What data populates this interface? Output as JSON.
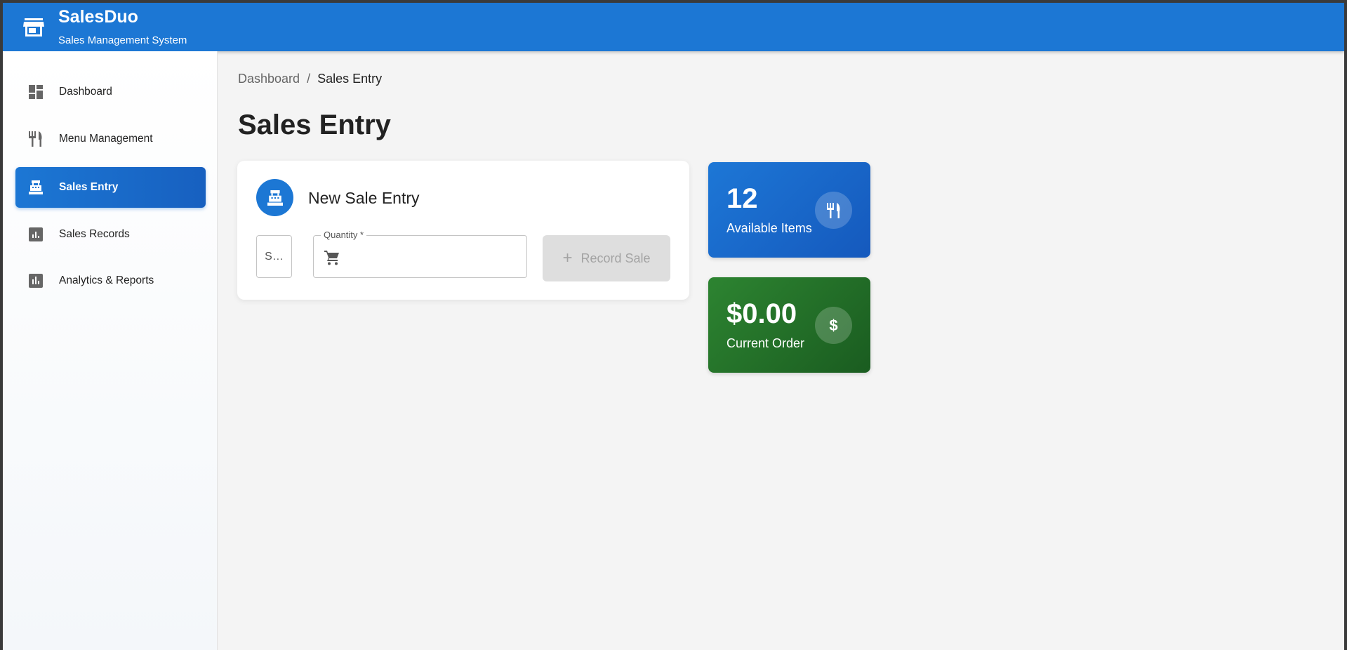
{
  "app": {
    "brand": "SalesDuo",
    "tagline": "Sales Management System",
    "brand_icon": "store-icon"
  },
  "sidebar": {
    "items": [
      {
        "label": "Dashboard",
        "icon": "dashboard-icon",
        "active": false
      },
      {
        "label": "Menu Management",
        "icon": "restaurant-icon",
        "active": false
      },
      {
        "label": "Sales Entry",
        "icon": "point-of-sale-icon",
        "active": true
      },
      {
        "label": "Sales Records",
        "icon": "assessment-icon",
        "active": false
      },
      {
        "label": "Analytics & Reports",
        "icon": "bar-chart-icon",
        "active": false
      }
    ]
  },
  "breadcrumb": {
    "root": "Dashboard",
    "separator": "/",
    "current": "Sales Entry"
  },
  "page": {
    "title": "Sales Entry"
  },
  "sale_form": {
    "title": "New Sale Entry",
    "select_value": "S…",
    "quantity_label": "Quantity *",
    "quantity_value": "",
    "record_button_label": "Record Sale",
    "record_button_disabled": true
  },
  "stats": {
    "available_items": {
      "value": "12",
      "label": "Available Items",
      "icon": "restaurant-icon",
      "color": "#1c77d4"
    },
    "current_order": {
      "value": "$0.00",
      "label": "Current Order",
      "icon": "dollar-icon",
      "color": "#2e7d32"
    }
  },
  "colors": {
    "primary": "#1c77d4",
    "success": "#2e7d32",
    "background": "#f4f4f4"
  }
}
